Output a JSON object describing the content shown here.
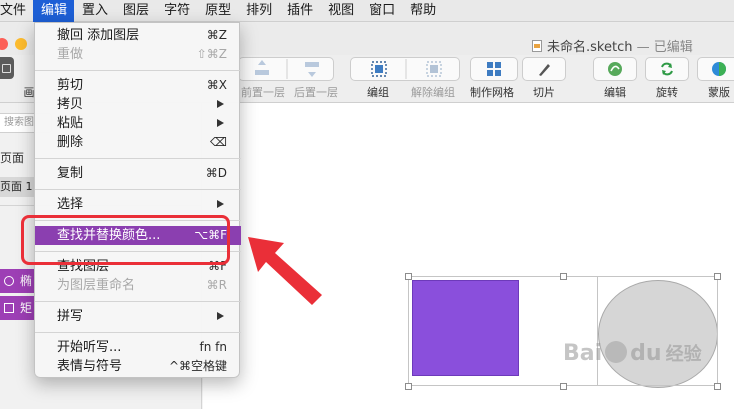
{
  "menubar": {
    "items": [
      "文件",
      "编辑",
      "置入",
      "图层",
      "字符",
      "原型",
      "排列",
      "插件",
      "视图",
      "窗口",
      "帮助"
    ],
    "active": "编辑"
  },
  "window": {
    "doc_title": "未命名.sketch",
    "doc_status": "— 已编辑"
  },
  "toolbar": {
    "left_partial": "画",
    "buttons": [
      {
        "label": "前置一层",
        "enabled": false
      },
      {
        "label": "后置一层",
        "enabled": false
      },
      {
        "label": "编组",
        "enabled": true
      },
      {
        "label": "解除编组",
        "enabled": false
      },
      {
        "label": "制作网格",
        "enabled": true
      },
      {
        "label": "切片",
        "enabled": true
      },
      {
        "label": "编辑",
        "enabled": true
      },
      {
        "label": "旋转",
        "enabled": true
      },
      {
        "label": "蒙版",
        "enabled": true
      }
    ]
  },
  "sidebar": {
    "search_placeholder": "搜索图",
    "pages_header": "页面",
    "page_item": "页面 1",
    "layers": [
      "椭",
      "矩"
    ]
  },
  "menu": {
    "items": [
      {
        "label": "撤回 添加图层",
        "shortcut": "⌘Z",
        "disabled": false
      },
      {
        "label": "重做",
        "shortcut": "⇧⌘Z",
        "disabled": true
      },
      {
        "label": "剪切",
        "shortcut": "⌘X",
        "disabled": false
      },
      {
        "label": "拷贝",
        "shortcut": "",
        "submenu": true,
        "disabled": false
      },
      {
        "label": "粘贴",
        "shortcut": "",
        "submenu": true,
        "disabled": false
      },
      {
        "label": "删除",
        "shortcut": "⌫",
        "disabled": false
      },
      {
        "label": "复制",
        "shortcut": "⌘D",
        "disabled": false
      },
      {
        "label": "选择",
        "shortcut": "",
        "submenu": true,
        "disabled": false
      },
      {
        "label": "查找并替换颜色...",
        "shortcut": "⌥⌘F",
        "highlighted": true,
        "disabled": false
      },
      {
        "label": "查找图层",
        "shortcut": "⌘F",
        "disabled": false
      },
      {
        "label": "为图层重命名",
        "shortcut": "⌘R",
        "disabled": true
      },
      {
        "label": "拼写",
        "shortcut": "",
        "submenu": true,
        "disabled": false
      },
      {
        "label": "开始听写...",
        "shortcut": "fn fn",
        "disabled": false
      },
      {
        "label": "表情与符号",
        "shortcut": "^⌘空格键",
        "disabled": false
      }
    ]
  },
  "watermark": {
    "brand": "Bai",
    "brand2": "du",
    "suffix": "经验"
  },
  "colors": {
    "menu_highlight": "#8b3fb0",
    "menubar_active": "#1d5fd6",
    "annotation_red": "#ea2f38",
    "rect_fill": "#8a4fdc",
    "circle_fill": "#d6d6d6",
    "layer_row": "#9d3fb5"
  }
}
